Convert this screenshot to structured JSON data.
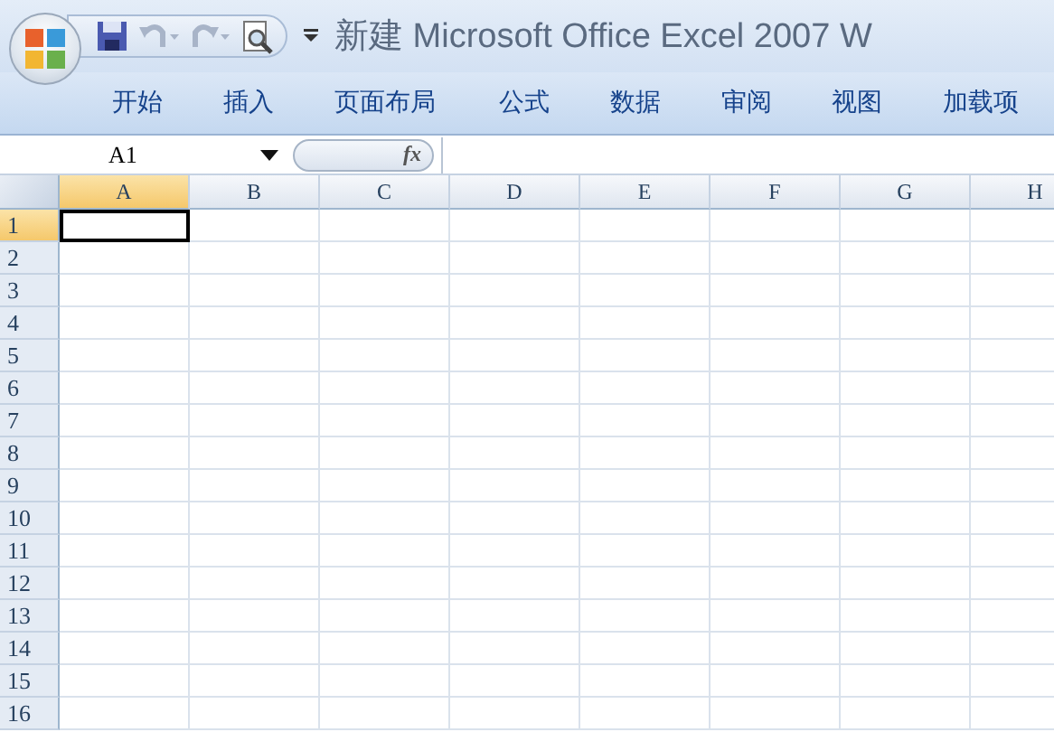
{
  "window": {
    "title": "新建 Microsoft Office Excel 2007 W"
  },
  "tabs": [
    {
      "label": "开始",
      "selected": false
    },
    {
      "label": "插入",
      "selected": false
    },
    {
      "label": "页面布局",
      "selected": false
    },
    {
      "label": "公式",
      "selected": false
    },
    {
      "label": "数据",
      "selected": false
    },
    {
      "label": "审阅",
      "selected": false
    },
    {
      "label": "视图",
      "selected": false
    },
    {
      "label": "加载项",
      "selected": false
    }
  ],
  "formula_bar": {
    "name_box": "A1",
    "function_button": "fx"
  },
  "sheet": {
    "columns": [
      {
        "label": "A",
        "selected": true
      },
      {
        "label": "B",
        "selected": false
      },
      {
        "label": "C",
        "selected": false
      },
      {
        "label": "D",
        "selected": false
      },
      {
        "label": "E",
        "selected": false
      },
      {
        "label": "F",
        "selected": false
      },
      {
        "label": "G",
        "selected": false
      },
      {
        "label": "H",
        "selected": false
      }
    ],
    "rows": [
      {
        "label": "1",
        "selected": true
      },
      {
        "label": "2",
        "selected": false
      },
      {
        "label": "3",
        "selected": false
      },
      {
        "label": "4",
        "selected": false
      },
      {
        "label": "5",
        "selected": false
      },
      {
        "label": "6",
        "selected": false
      },
      {
        "label": "7",
        "selected": false
      },
      {
        "label": "8",
        "selected": false
      },
      {
        "label": "9",
        "selected": false
      },
      {
        "label": "10",
        "selected": false
      },
      {
        "label": "11",
        "selected": false
      },
      {
        "label": "12",
        "selected": false
      },
      {
        "label": "13",
        "selected": false
      },
      {
        "label": "14",
        "selected": false
      },
      {
        "label": "15",
        "selected": false
      },
      {
        "label": "16",
        "selected": false
      }
    ]
  }
}
